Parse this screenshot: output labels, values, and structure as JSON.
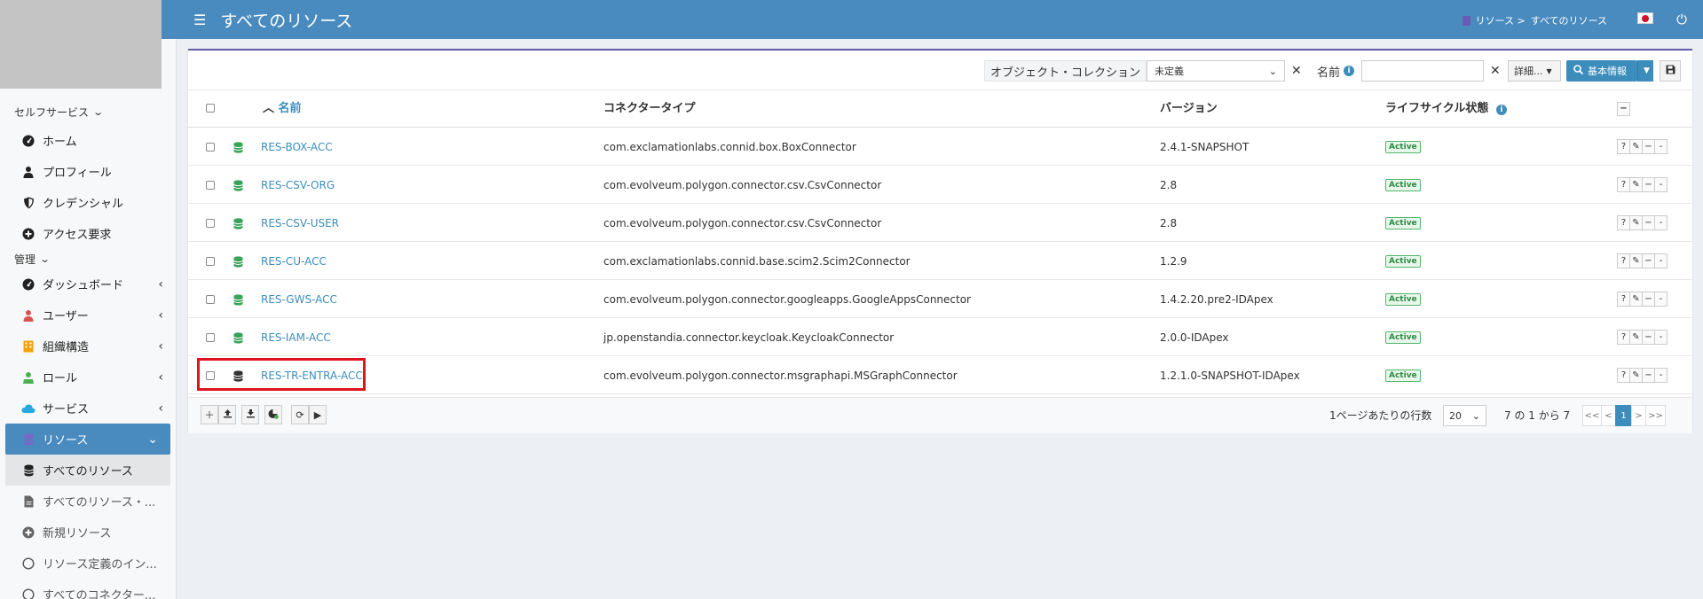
{
  "sidebar": {
    "section_self": "セルフサービス",
    "self_items": [
      {
        "label": "ホーム",
        "icon": "dashboard-icon"
      },
      {
        "label": "プロフィール",
        "icon": "user-icon"
      },
      {
        "label": "クレデンシャル",
        "icon": "shield-icon"
      },
      {
        "label": "アクセス要求",
        "icon": "plus-circle-icon"
      }
    ],
    "section_admin": "管理",
    "admin_items": [
      {
        "label": "ダッシュボード",
        "icon": "dashboard-icon"
      },
      {
        "label": "ユーザー",
        "icon": "user-icon"
      },
      {
        "label": "組織構造",
        "icon": "building-icon"
      },
      {
        "label": "ロール",
        "icon": "role-icon"
      },
      {
        "label": "サービス",
        "icon": "cloud-icon"
      },
      {
        "label": "リソース",
        "icon": "database-icon"
      }
    ],
    "resource_sub": [
      {
        "label": "すべてのリソース"
      },
      {
        "label": "すべてのリソース・..."
      },
      {
        "label": "新規リソース"
      },
      {
        "label": "リソース定義のイン..."
      },
      {
        "label": "すべてのコネクター..."
      }
    ]
  },
  "topbar": {
    "title": "すべてのリソース",
    "breadcrumb_parent": "リソース >",
    "breadcrumb_current": "すべてのリソース",
    "color": "#4a8bbf"
  },
  "toolbar": {
    "collection_label": "オブジェクト・コレクション",
    "collection_value": "未定義",
    "clear": "✕",
    "name_label": "名前",
    "name_info": "i",
    "name_value": "",
    "more_label": "詳細...",
    "basic_label": "基本情報"
  },
  "table": {
    "headers": {
      "name": "名前",
      "connector": "コネクタータイプ",
      "version": "バージョン",
      "lifecycle": "ライフサイクル状態"
    },
    "rows": [
      {
        "name": "RES-BOX-ACC",
        "connector": "com.exclamationlabs.connid.box.BoxConnector",
        "version": "2.4.1-SNAPSHOT",
        "status": "Active"
      },
      {
        "name": "RES-CSV-ORG",
        "connector": "com.evolveum.polygon.connector.csv.CsvConnector",
        "version": "2.8",
        "status": "Active"
      },
      {
        "name": "RES-CSV-USER",
        "connector": "com.evolveum.polygon.connector.csv.CsvConnector",
        "version": "2.8",
        "status": "Active"
      },
      {
        "name": "RES-CU-ACC",
        "connector": "com.exclamationlabs.connid.base.scim2.Scim2Connector",
        "version": "1.2.9",
        "status": "Active"
      },
      {
        "name": "RES-GWS-ACC",
        "connector": "com.evolveum.polygon.connector.googleapps.GoogleAppsConnector",
        "version": "1.4.2.20.pre2-IDApex",
        "status": "Active"
      },
      {
        "name": "RES-IAM-ACC",
        "connector": "jp.openstandia.connector.keycloak.KeycloakConnector",
        "version": "2.0.0-IDApex",
        "status": "Active"
      },
      {
        "name": "RES-TR-ENTRA-ACC",
        "connector": "com.evolveum.polygon.connector.msgraphapi.MSGraphConnector",
        "version": "1.2.1.0-SNAPSHOT-IDApex",
        "status": "Active"
      }
    ],
    "row_actions": [
      "?",
      "✎",
      "−",
      "-"
    ]
  },
  "footer": {
    "rows_per_page_label": "1ページあたりの行数",
    "rows_per_page": "20",
    "range_text": "7 の 1 から 7",
    "pages": [
      "<<",
      "<",
      "1",
      ">",
      ">>"
    ],
    "current_page": "1"
  }
}
